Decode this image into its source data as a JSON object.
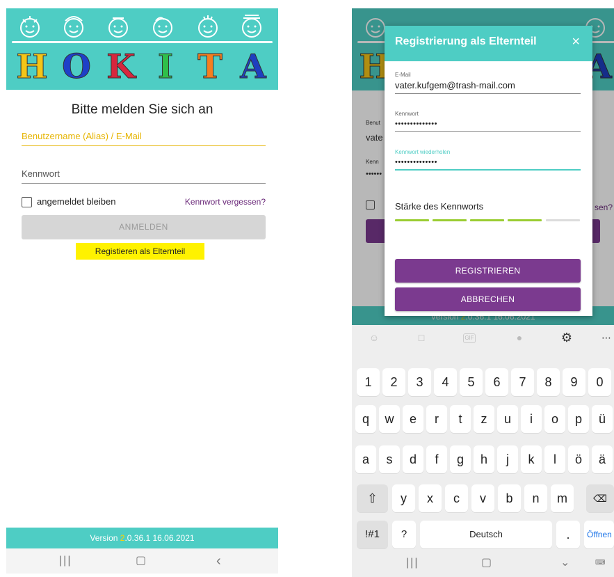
{
  "left": {
    "logo_letters": [
      "H",
      "O",
      "K",
      "I",
      "T",
      "A"
    ],
    "logo_colors": [
      "#f5c518",
      "#1e40c8",
      "#d7263d",
      "#2fbf4a",
      "#f57e1f",
      "#1e3fbf"
    ],
    "title": "Bitte melden Sie sich an",
    "username_placeholder": "Benutzername (Alias) / E-Mail",
    "password_placeholder": "Kennwort",
    "remember_label": "angemeldet bleiben",
    "forgot_link": "Kennwort vergessen?",
    "login_button": "ANMELDEN",
    "register_button": "Registieren als Elternteil",
    "version_prefix": "Version ",
    "version_highlight": "2",
    "version_rest": ".0.36.1 16.06.2021"
  },
  "right": {
    "background": {
      "label_user": "Benut",
      "value_user": "vate",
      "label_pw": "Kenn",
      "value_pw": "••••••",
      "link_partial": "sen?",
      "version_prefix": "Version ",
      "version_highlight": "2",
      "version_rest": ".0.36.1 16.06.2021"
    },
    "dialog": {
      "title": "Registrierung als Elternteil",
      "close": "×",
      "email_label": "E-Mail",
      "email_value": "vater.kufgem@trash-mail.com",
      "password_label": "Kennwort",
      "password_value": "••••••••••••••",
      "repeat_label": "Kennwort wiederholen",
      "repeat_value": "••••••••••••••",
      "strength_label": "Stärke des Kennworts",
      "strength_level": 0.8,
      "register_button": "REGISTRIEREN",
      "cancel_button": "ABBRECHEN"
    },
    "keyboard": {
      "toolbar": [
        "smiley-icon",
        "sticker-icon",
        "gif-icon",
        "mic-icon",
        "settings-icon",
        "more-icon"
      ],
      "row1": [
        "1",
        "2",
        "3",
        "4",
        "5",
        "6",
        "7",
        "8",
        "9",
        "0"
      ],
      "row2": [
        "q",
        "w",
        "e",
        "r",
        "t",
        "z",
        "u",
        "i",
        "o",
        "p",
        "ü"
      ],
      "row3": [
        "a",
        "s",
        "d",
        "f",
        "g",
        "h",
        "j",
        "k",
        "l",
        "ö",
        "ä"
      ],
      "row4": [
        "y",
        "x",
        "c",
        "v",
        "b",
        "n",
        "m"
      ],
      "symbols_key": "!#1",
      "question_key": "?",
      "space_label": "Deutsch",
      "period_key": ".",
      "open_key": "Öffnen"
    }
  },
  "colors": {
    "teal": "#4ecdc4",
    "purple": "#7b3a8f",
    "yellow": "#fff200",
    "strength_green": "#9acd32"
  }
}
